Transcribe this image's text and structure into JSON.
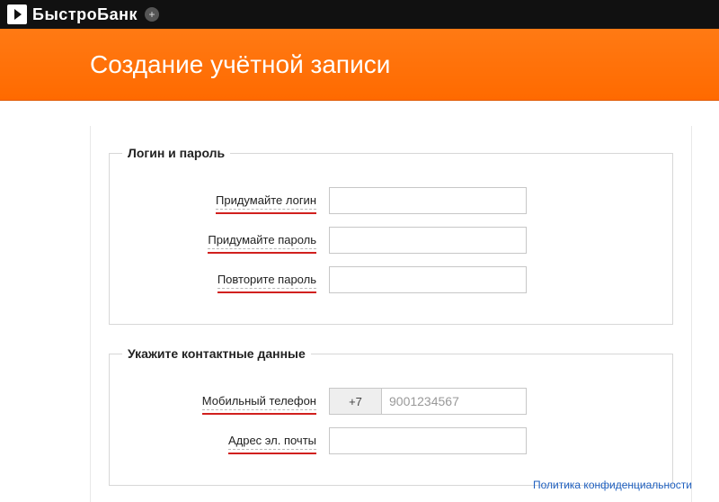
{
  "brand": "БыстроБанк",
  "page_title": "Создание учётной записи",
  "sections": {
    "login": {
      "legend": "Логин и пароль",
      "login_label": "Придумайте логин",
      "login_value": "",
      "pass_label": "Придумайте пароль",
      "pass_value": "",
      "pass2_label": "Повторите пароль",
      "pass2_value": ""
    },
    "contact": {
      "legend": "Укажите контактные данные",
      "phone_label": "Мобильный телефон",
      "phone_prefix": "+7",
      "phone_placeholder": "9001234567",
      "phone_value": "",
      "email_label": "Адрес эл. почты",
      "email_value": ""
    }
  },
  "footer": {
    "privacy": "Политика конфиденциальности"
  }
}
